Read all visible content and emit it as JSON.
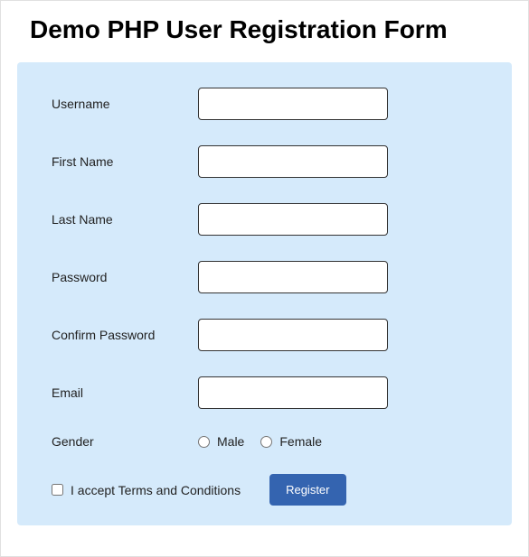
{
  "title": "Demo PHP User Registration Form",
  "fields": {
    "username": {
      "label": "Username",
      "value": ""
    },
    "firstname": {
      "label": "First Name",
      "value": ""
    },
    "lastname": {
      "label": "Last Name",
      "value": ""
    },
    "password": {
      "label": "Password",
      "value": ""
    },
    "confirm_password": {
      "label": "Confirm Password",
      "value": ""
    },
    "email": {
      "label": "Email",
      "value": ""
    },
    "gender": {
      "label": "Gender",
      "options": {
        "male": "Male",
        "female": "Female"
      }
    }
  },
  "terms": {
    "label": "I accept Terms and Conditions",
    "checked": false
  },
  "buttons": {
    "register": "Register"
  }
}
